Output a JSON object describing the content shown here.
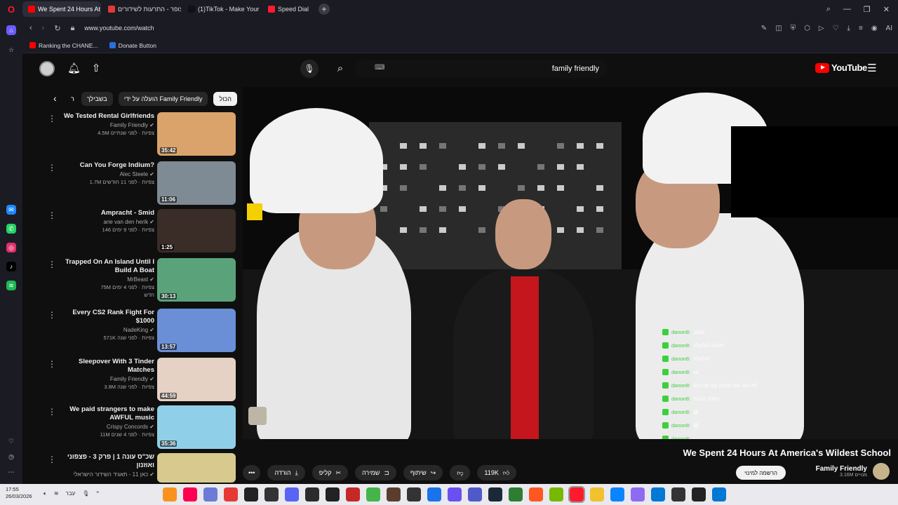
{
  "browser": {
    "tabs": [
      {
        "label": "We Spent 24 Hours At An",
        "color": "#ff0000",
        "active": true
      },
      {
        "label": "צופר - התרעות לשידורים",
        "color": "#e53935",
        "active": false
      },
      {
        "label": "(1)TikTok - Make Your Day",
        "color": "#111111",
        "active": false
      },
      {
        "label": "Speed Dial",
        "color": "#ff1b2d",
        "active": false
      }
    ],
    "url": "www.youtube.com/watch",
    "bookmarks": [
      {
        "label": "Ranking the CHANE...",
        "color": "#ff0000"
      },
      {
        "label": "Donate Button",
        "color": "#2a6fdb"
      }
    ]
  },
  "youtube": {
    "logo_text": "YouTube",
    "search_value": "family friendly",
    "chips": [
      "הכול",
      "הועלה על ידי Family Friendly",
      "בשבילך",
      "ר"
    ],
    "related": [
      {
        "title": "We Tested Rental Girlfriends",
        "channel": "Family Friendly",
        "stats": "4.5M צפיות · לפני שנתיים",
        "duration": "35:42",
        "thumb": "#d9a36b"
      },
      {
        "title": "Can You Forge Indium?",
        "channel": "Alec Steele",
        "stats": "1.7M צפיות · לפני 11 חודשים",
        "duration": "11:06",
        "thumb": "#7e8a94"
      },
      {
        "title": "Ampracht - Smid",
        "channel": "arie van den herik",
        "stats": "146 צפיות · לפני 9 ימים",
        "duration": "1:25",
        "thumb": "#3a2c26"
      },
      {
        "title": "Trapped On An Island Until I Build A Boat",
        "channel": "MrBeast",
        "stats": "75M צפיות · לפני 4 ימים",
        "extra": "חדש",
        "duration": "30:13",
        "thumb": "#5aa37a"
      },
      {
        "title": "Every CS2 Rank Fight For $1000",
        "channel": "NadeKing",
        "stats": "571K צפיות · לפני שנה",
        "duration": "13:57",
        "thumb": "#6b8fd6"
      },
      {
        "title": "Sleepover With 3 Tinder Matches",
        "channel": "Family Friendly",
        "stats": "3.8M צפיות · לפני שנה",
        "duration": "44:59",
        "thumb": "#e6d2c4"
      },
      {
        "title": "We paid strangers to make AWFUL music",
        "channel": "Crispy Concords",
        "stats": "11M צפיות · לפני 4 שנים",
        "duration": "35:36",
        "thumb": "#8fd0e8"
      },
      {
        "title": "שכ\"ס עונה 1 | פרק 3 - פצפוני ואוזנון",
        "channel": "כאן 11 - תאגיד השידור הישראלי",
        "stats": "",
        "duration": "",
        "thumb": "#d8c98e"
      }
    ],
    "video_title": "We Spent 24 Hours At America's Wildest School",
    "actions": {
      "likes": "119K",
      "share": "שיתוף",
      "save": "שמירה",
      "clip": "קליפ",
      "download": "הורדה"
    },
    "channel_name": "Family Friendly",
    "channel_subs": "3.16M מנויים",
    "subscribe_label": "הרשמה למינוי",
    "chat": [
      {
        "name": "danon8:",
        "msg": "סטוב"
      },
      {
        "name": "danon8:",
        "msg": "העלה לגלעלה"
      },
      {
        "name": "danon8:",
        "msg": "לגלעלה"
      },
      {
        "name": "danon8:",
        "msg": "עוו"
      },
      {
        "name": "danon8:",
        "msg": "לא היה שם סרטון עם זוס כנס"
      },
      {
        "name": "danon8:",
        "msg": "העלה הרבה"
      },
      {
        "name": "danon8:",
        "msg": "😆"
      },
      {
        "name": "danon8:",
        "msg": "😆"
      },
      {
        "name": "danon8:",
        "msg": ""
      },
      {
        "name": "danon8:",
        "msg": ""
      },
      {
        "name": "danon8:",
        "msg": ""
      }
    ]
  },
  "taskbar": {
    "time": "17:55",
    "date": "26/03/2026",
    "lang": "עבר"
  }
}
